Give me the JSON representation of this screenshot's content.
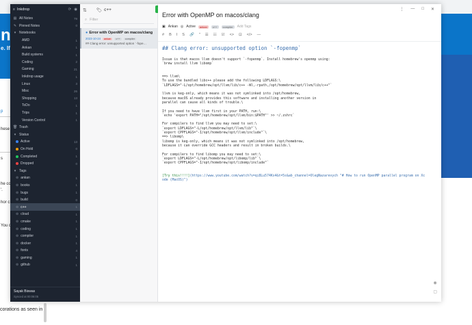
{
  "background": {
    "band_letter": "n",
    "band_sub": "e. If",
    "side_texts": [
      "p",
      "hese",
      "s",
      "he co",
      "'.",
      "hor c",
      "You c"
    ],
    "bottom_text": "corations as seen in"
  },
  "sidebar": {
    "app_name": "Inkdrop",
    "sections": {
      "all_notes": {
        "label": "All Notes",
        "count": "79"
      },
      "pinned": {
        "label": "Pinned Notes",
        "count": "0"
      },
      "notebooks_header": "Notebooks",
      "trash": "Trash",
      "status_header": "Status",
      "tags_header": "Tags"
    },
    "notebooks": [
      {
        "label": "AMD",
        "count": "1"
      },
      {
        "label": "Ankan",
        "count": "1"
      },
      {
        "label": "Build systems",
        "count": "1"
      },
      {
        "label": "Coding",
        "count": "2"
      },
      {
        "label": "Gaming",
        "count": "21"
      },
      {
        "label": "Inkdrop usage",
        "count": "1"
      },
      {
        "label": "Linux",
        "count": "3"
      },
      {
        "label": "Misc",
        "count": "26"
      },
      {
        "label": "Shopping",
        "count": "13"
      },
      {
        "label": "ToDo",
        "count": "1"
      },
      {
        "label": "Trips",
        "count": "1"
      },
      {
        "label": "Version Control",
        "count": "1"
      }
    ],
    "statuses": [
      {
        "label": "Active",
        "count": "13",
        "color": "#3b82f6"
      },
      {
        "label": "On Hold",
        "count": "0",
        "color": "#f59e0b"
      },
      {
        "label": "Completed",
        "count": "1",
        "color": "#22c55e"
      },
      {
        "label": "Dropped",
        "count": "0",
        "color": "#ef4444"
      }
    ],
    "tags": [
      {
        "label": "ankan",
        "count": "1",
        "active": false
      },
      {
        "label": "books",
        "count": "1",
        "active": false
      },
      {
        "label": "bugs",
        "count": "1",
        "active": false
      },
      {
        "label": "build",
        "count": "0",
        "active": false
      },
      {
        "label": "c++",
        "count": "1",
        "active": true
      },
      {
        "label": "cloud",
        "count": "1",
        "active": false
      },
      {
        "label": "cmake",
        "count": "1",
        "active": false
      },
      {
        "label": "coding",
        "count": "1",
        "active": false
      },
      {
        "label": "compiler",
        "count": "1",
        "active": false
      },
      {
        "label": "docker",
        "count": "1",
        "active": false
      },
      {
        "label": "fonts",
        "count": "4",
        "active": false
      },
      {
        "label": "gaming",
        "count": "1",
        "active": false
      },
      {
        "label": "github",
        "count": "1",
        "active": false
      }
    ],
    "footer": {
      "user": "Sayak Biswas",
      "sync": "Synced at 00:06:05"
    }
  },
  "notelist": {
    "title": "c++",
    "filter_placeholder": "Filter",
    "new_note_label": "+",
    "items": [
      {
        "title": "Error with OpenMP on macos/clang",
        "date": "2023-10-24",
        "tags": [
          "ankan",
          "c++",
          "compiler"
        ],
        "preview": "## Clang error: unsupported option `-fope…"
      }
    ]
  },
  "editor": {
    "title": "Error with OpenMP on macos/clang",
    "notebook": "Ankan",
    "status": "Active",
    "tags": [
      "ankan",
      "c++",
      "compiler"
    ],
    "add_tags": "Add Tags",
    "toolbar": [
      "#",
      "B",
      "I",
      "S",
      "🔗",
      "\"",
      "☰",
      "☷",
      "☑",
      "<>",
      "⊡",
      "</>",
      "—"
    ],
    "heading": "## Clang error: unsupported option `-fopenmp`",
    "lines": [
      "Issue is that macos llvm doesn't support `-fopenmp`. Install homebrew's openmp using:",
      "`brew install llvm libomp`",
      "",
      "",
      "==> llvm\\",
      "To use the bundled libc++ please add the following LDFLAGS:\\",
      "  `LDFLAGS=\"-L/opt/homebrew/opt/llvm/lib/c++ -Wl,-rpath,/opt/homebrew/opt/llvm/lib/c++\"`",
      "",
      "llvm is keg-only, which means it was not symlinked into /opt/homebrew,",
      "because macOS already provides this software and installing another version in",
      "parallel can cause all kinds of trouble.\\",
      "",
      "If you need to have llvm first in your PATH, run:\\",
      "  `echo 'export PATH=\"/opt/homebrew/opt/llvm/bin:$PATH\"' >> ~/.zshrc`",
      "",
      "For compilers to find llvm you may need to set:\\",
      "  `export LDFLAGS=\"-L/opt/homebrew/opt/llvm/lib\"`\\",
      "  `export CPPFLAGS=\"-I/opt/homebrew/opt/llvm/include\"`\\",
      "==> libomp\\",
      "libomp is keg-only, which means it was not symlinked into /opt/homebrew,",
      "because it can override GCC headers and result in broken builds.\\",
      "",
      "For compilers to find libomp you may need to set:\\",
      "  `export LDFLAGS=\"-L/opt/homebrew/opt/libomp/lib\"`\\",
      "  `export CPPFLAGS=\"-I/opt/homebrew/opt/libomp/include\"`",
      "",
      ""
    ],
    "link_text": "[Try this!!!!]",
    "link_url_1": "(https://www.youtube.com/watch?v=qi8Lu574Kx4&t=5s&ab_channel=OlegNazarevych \"# How to run OpenMP parallel program on Xc",
    "link_url_2": "ode (MacOS)\")"
  }
}
